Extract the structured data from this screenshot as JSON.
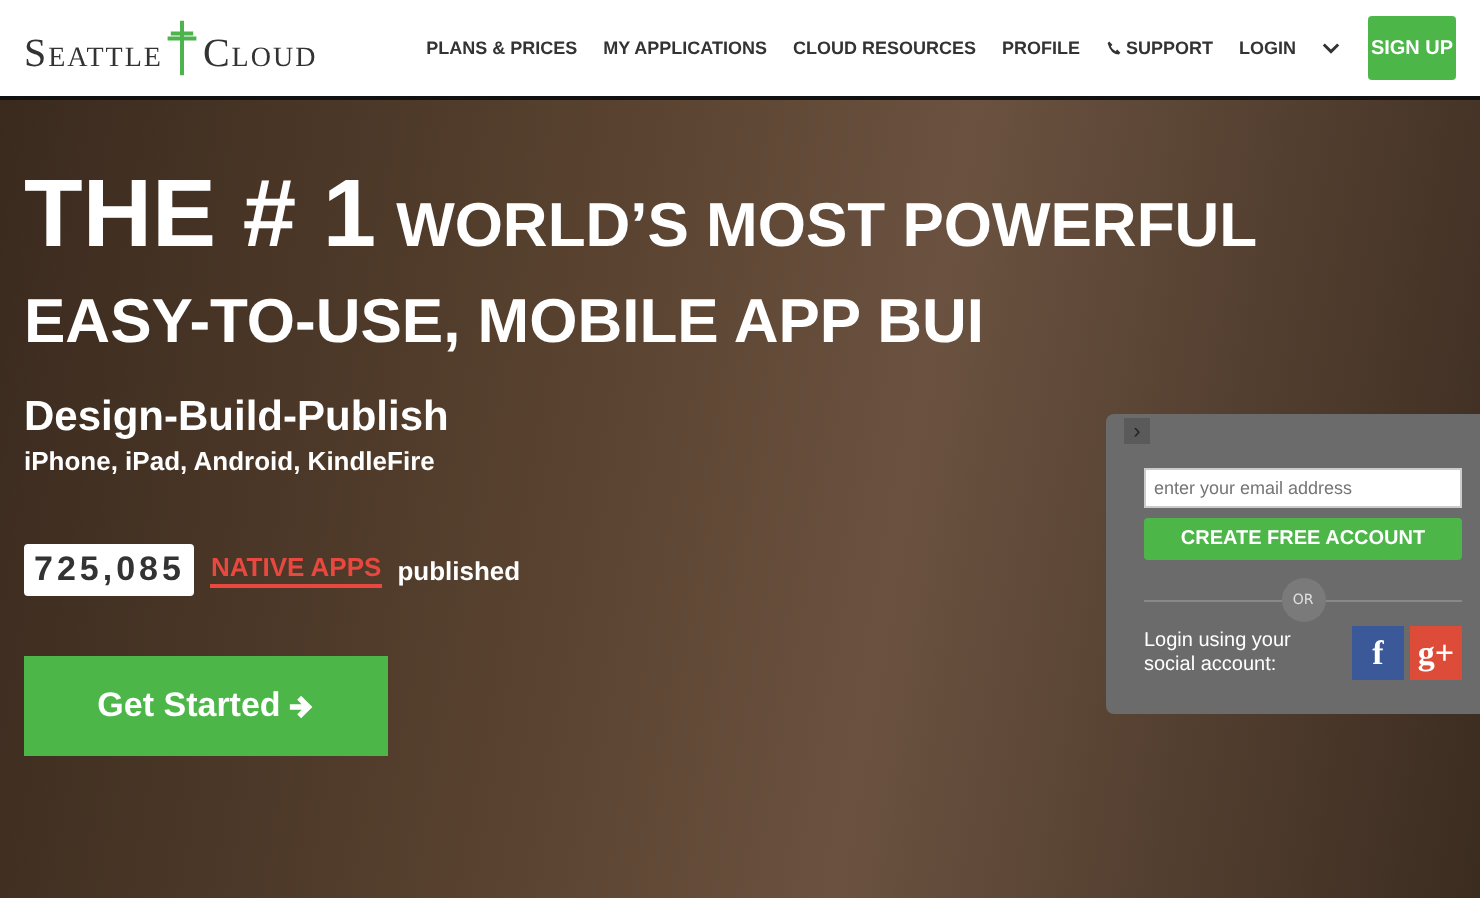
{
  "header": {
    "logo": {
      "word_1": "Seattle",
      "word_2": "Cloud"
    },
    "nav": [
      {
        "label": "PLANS & PRICES",
        "kind": "link"
      },
      {
        "label": "MY APPLICATIONS",
        "kind": "link"
      },
      {
        "label": "CLOUD RESOURCES",
        "kind": "link"
      },
      {
        "label": "PROFILE",
        "kind": "link"
      },
      {
        "label": "SUPPORT",
        "kind": "phone"
      },
      {
        "label": "LOGIN",
        "kind": "link"
      },
      {
        "kind": "caret"
      }
    ],
    "signup": "SIGN UP"
  },
  "hero": {
    "headline_1": "THE # 1",
    "headline_2": "WORLD’S MOST POWERFUL",
    "headline_3": "EASY-TO-USE, MOBILE APP BUI",
    "subtitle": "Design-Build-Publish",
    "platforms": "iPhone, iPad, Android, KindleFire",
    "counter": "725,085",
    "counter_link": "NATIVE APPS",
    "counter_suffix": "published",
    "cta": "Get Started"
  },
  "signup_panel": {
    "toggle": "›",
    "email": {
      "placeholder": "enter your email address"
    },
    "create": "CREATE FREE ACCOUNT",
    "or": "OR",
    "social_text": "Login using your social account:",
    "social": [
      {
        "label": "f",
        "kind": "facebook"
      },
      {
        "label": "g+",
        "kind": "google"
      }
    ]
  }
}
